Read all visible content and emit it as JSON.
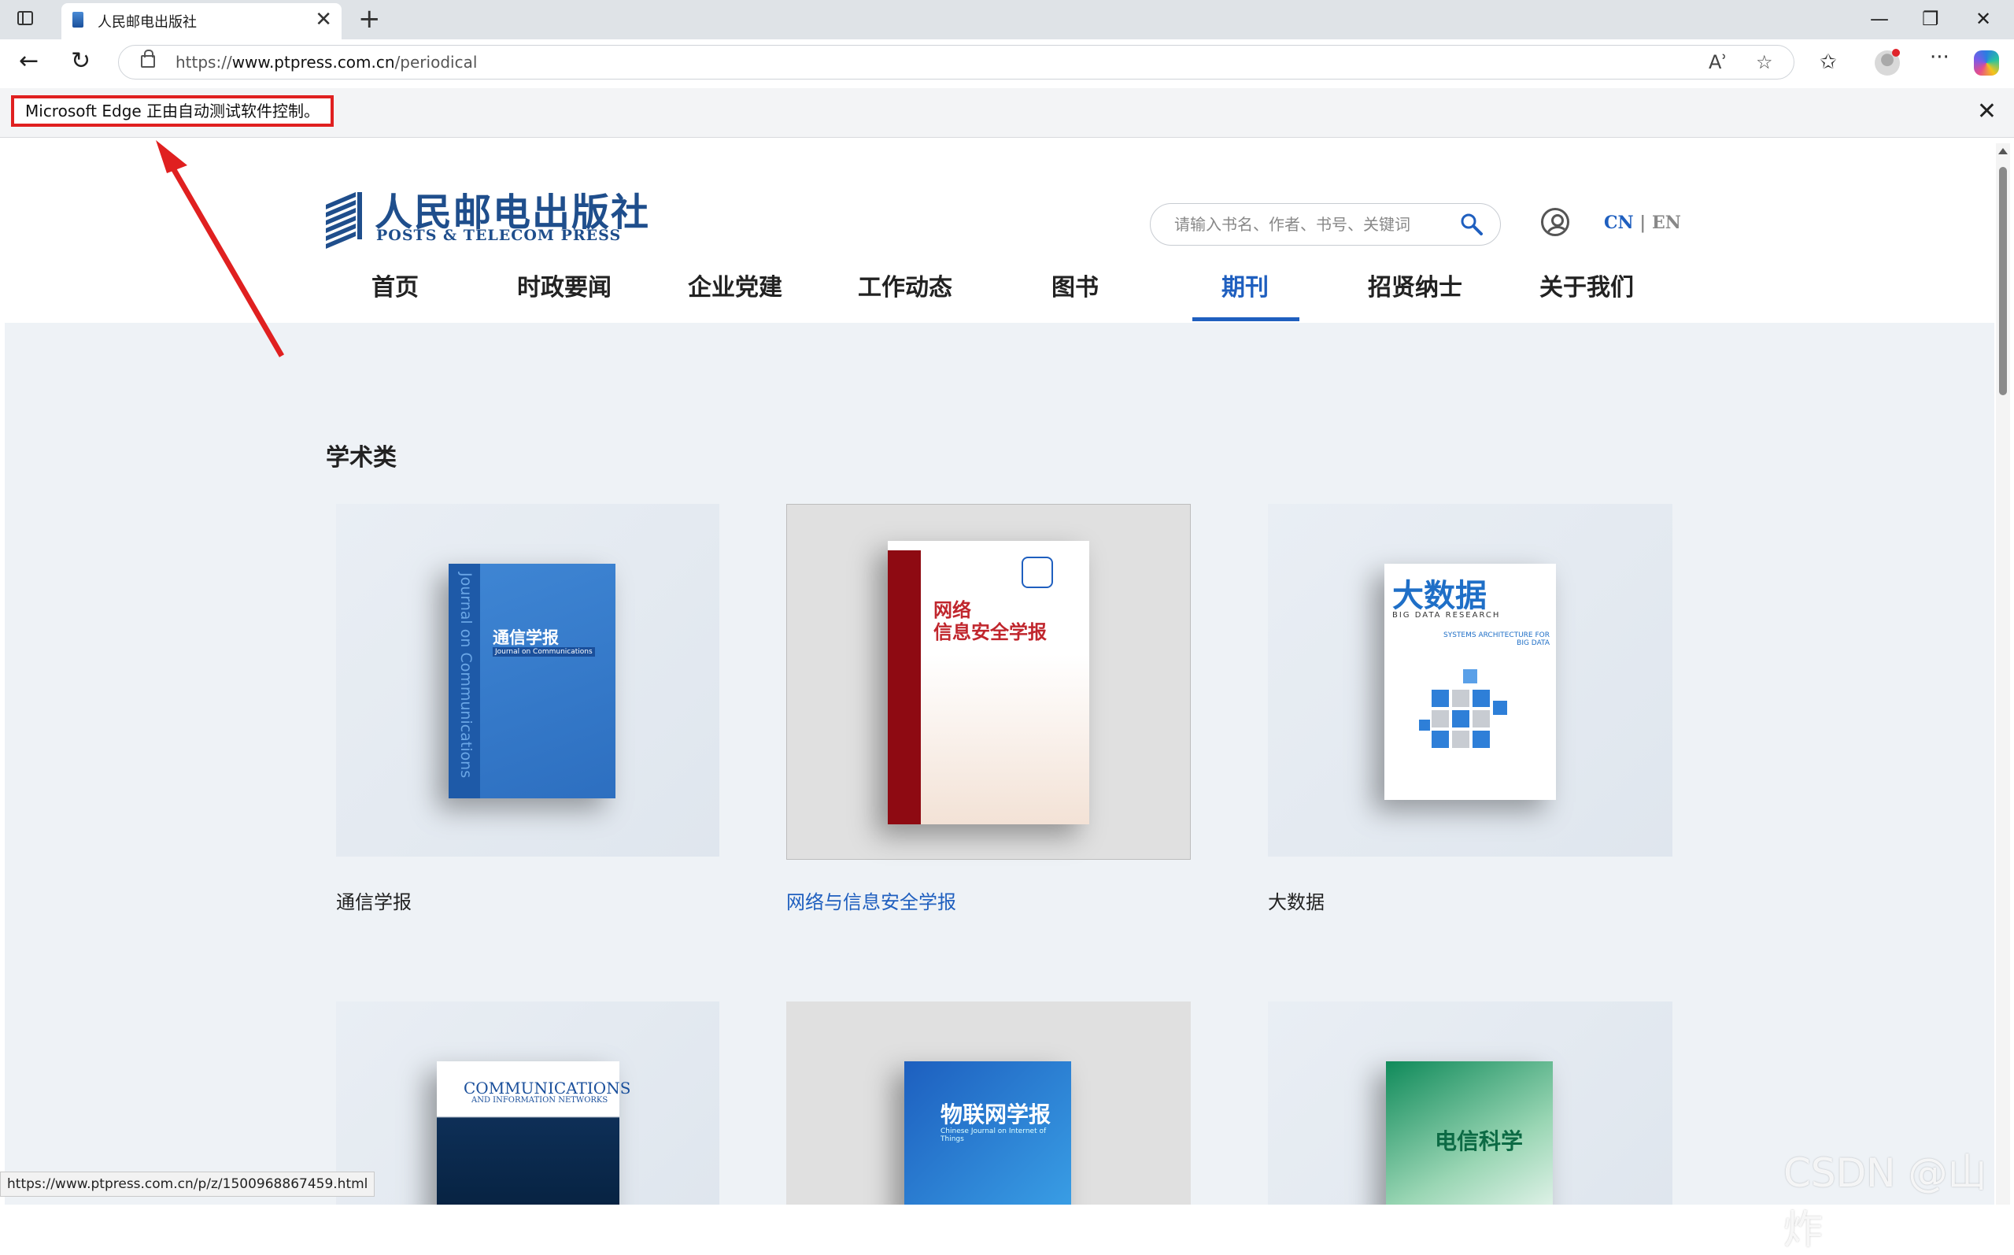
{
  "browser": {
    "tab_title": "人民邮电出版社",
    "tab_close": "✕",
    "new_tab": "+",
    "url_prefix": "https://",
    "url_host": "www.ptpress.com.cn",
    "url_path": "/periodical",
    "read_aloud": "Aʾ",
    "favorite": "☆",
    "favorites_list": "✩",
    "more": "···",
    "minimize": "—",
    "restore": "❐",
    "close": "✕"
  },
  "infobar": {
    "message": "Microsoft Edge 正由自动测试软件控制。",
    "close": "✕"
  },
  "site": {
    "logo_cn": "人民邮电出版社",
    "logo_en": "POSTS & TELECOM PRESS",
    "search_placeholder": "请输入书名、作者、书号、关键词",
    "lang_cn": "CN",
    "lang_sep": "|",
    "lang_en": "EN",
    "nav": [
      "首页",
      "时政要闻",
      "企业党建",
      "工作动态",
      "图书",
      "期刊",
      "招贤纳士",
      "关于我们"
    ],
    "active_nav": "期刊"
  },
  "section": {
    "title": "学术类",
    "cards": [
      {
        "label": "通信学报",
        "cover_title": "通信学报",
        "cover_sub": "Journal on Communications",
        "spine": "Journal on Communications"
      },
      {
        "label": "网络与信息安全学报",
        "cover_title_1": "网络",
        "cover_title_2": "信息安全学报"
      },
      {
        "label": "大数据",
        "cover_title": "大数据",
        "cover_sub": "BIG DATA RESEARCH",
        "cover_tag": "SYSTEMS ARCHITECTURE FOR BIG DATA"
      },
      {
        "cover_title": "COMMUNICATIONS",
        "cover_sub": "AND INFORMATION NETWORKS"
      },
      {
        "cover_title": "物联网学报",
        "cover_sub": "Chinese Journal on Internet of Things"
      },
      {
        "cover_title": "电信科学"
      }
    ]
  },
  "status_url": "https://www.ptpress.com.cn/p/z/1500968867459.html",
  "watermark": "CSDN @山炸",
  "colors": {
    "brand": "#1f4e8c",
    "accent": "#1f5fbf",
    "annotation_red": "#e02020"
  }
}
